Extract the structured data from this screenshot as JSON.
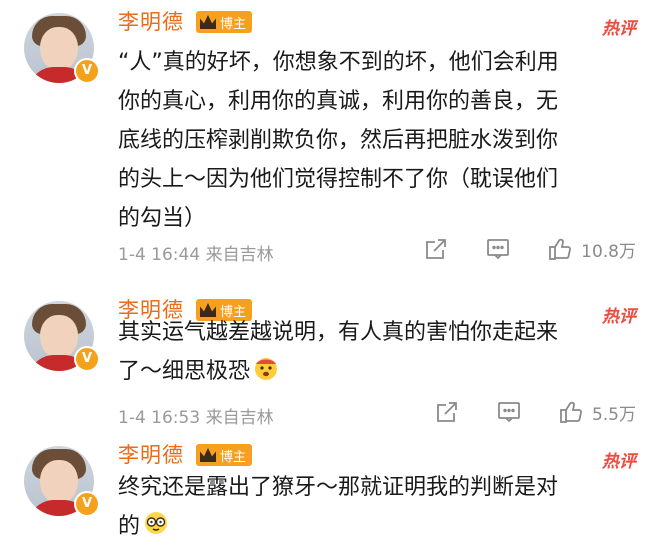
{
  "comments": [
    {
      "username": "李明德",
      "badge": "博主",
      "hot_tag": "热评",
      "text_lines": [
        "“人”真的好坏，你想象不到的坏，他们会利用",
        "你的真心，利用你的真诚，利用你的善良，无",
        "底线的压榨剥削欺负你，然后再把脏水泼到你",
        "的头上～因为他们觉得控制不了你（耽误他们",
        "的勾当）"
      ],
      "meta": "1-4 16:44 来自吉林",
      "likes": "10.8万"
    },
    {
      "username": "李明德",
      "badge": "博主",
      "hot_tag": "热评",
      "text_lines": [
        "其实运气越差越说明，有人真的害怕你走起来",
        "了～细思极恐"
      ],
      "emoji": "scared-face-emoji",
      "meta": "1-4 16:53 来自吉林",
      "likes": "5.5万"
    },
    {
      "username": "李明德",
      "badge": "博主",
      "hot_tag": "热评",
      "text_lines": [
        "终究还是露出了獠牙～那就证明我的判断是对",
        "的"
      ],
      "emoji": "glasses-face-emoji"
    }
  ],
  "colors": {
    "username": "#e86b18",
    "badge_bg": "#f7a020",
    "hot_tag": "#ee4b3f",
    "meta": "#9a9a9a"
  }
}
